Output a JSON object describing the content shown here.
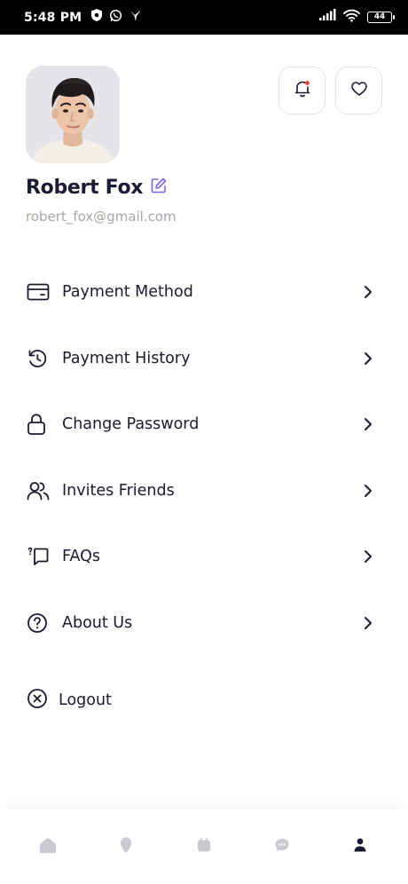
{
  "status_bar": {
    "time": "5:48 PM",
    "battery": "44",
    "icons": [
      "shield-icon",
      "whatsapp-icon",
      "bird-icon",
      "signal-icon",
      "wifi-icon",
      "battery-icon"
    ]
  },
  "profile": {
    "name": "Robert Fox",
    "email": "robert_fox@gmail.com"
  },
  "header_actions": {
    "icons": [
      "bell-icon",
      "heart-icon"
    ],
    "notification_dot_color": "#ff3b3b"
  },
  "menu": {
    "items": [
      {
        "label": "Payment Method",
        "icon": "card-icon"
      },
      {
        "label": "Payment History",
        "icon": "history-icon"
      },
      {
        "label": "Change Password",
        "icon": "lock-icon"
      },
      {
        "label": "Invites Friends",
        "icon": "users-icon"
      },
      {
        "label": "FAQs",
        "icon": "faq-icon"
      },
      {
        "label": "About Us",
        "icon": "help-circle-icon"
      }
    ],
    "logout_label": "Logout"
  },
  "bottom_nav": {
    "items": [
      "home-icon",
      "location-icon",
      "calendar-icon",
      "chat-icon",
      "profile-icon"
    ],
    "active": "profile-icon",
    "active_color": "#1b1b35",
    "inactive_color": "#c9c9d1"
  },
  "colors": {
    "accent_edit": "#7b61ff",
    "text_primary": "#1b1b35",
    "text_muted": "#a6a6ae"
  }
}
